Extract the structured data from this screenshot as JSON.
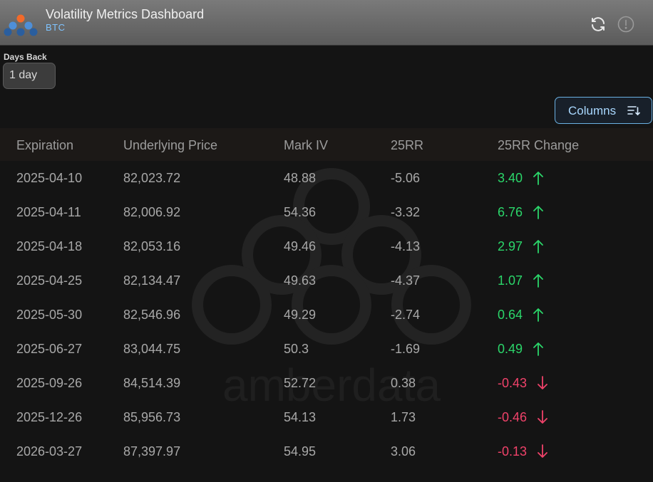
{
  "header": {
    "title": "Volatility Metrics Dashboard",
    "subtitle": "BTC",
    "icons": {
      "logo": "amberdata-logo",
      "refresh": "refresh-icon",
      "info": "alert-circle-icon"
    }
  },
  "filters": {
    "days_back_label": "Days Back",
    "days_back_value": "1 day"
  },
  "toolbar": {
    "columns_label": "Columns",
    "columns_icon": "sort-lines-icon"
  },
  "watermark_text": "amberdata",
  "colors": {
    "positive": "#2bd66a",
    "negative": "#f0426a",
    "accent": "#6bb2e4"
  },
  "table": {
    "headers": [
      "Expiration",
      "Underlying Price",
      "Mark IV",
      "25RR",
      "25RR Change"
    ],
    "rows": [
      {
        "expiration": "2025-04-10",
        "price": "82,023.72",
        "mark_iv": "48.88",
        "rr25": "-5.06",
        "change": "3.40",
        "dir": "up"
      },
      {
        "expiration": "2025-04-11",
        "price": "82,006.92",
        "mark_iv": "54.36",
        "rr25": "-3.32",
        "change": "6.76",
        "dir": "up"
      },
      {
        "expiration": "2025-04-18",
        "price": "82,053.16",
        "mark_iv": "49.46",
        "rr25": "-4.13",
        "change": "2.97",
        "dir": "up"
      },
      {
        "expiration": "2025-04-25",
        "price": "82,134.47",
        "mark_iv": "49.63",
        "rr25": "-4.37",
        "change": "1.07",
        "dir": "up"
      },
      {
        "expiration": "2025-05-30",
        "price": "82,546.96",
        "mark_iv": "49.29",
        "rr25": "-2.74",
        "change": "0.64",
        "dir": "up"
      },
      {
        "expiration": "2025-06-27",
        "price": "83,044.75",
        "mark_iv": "50.3",
        "rr25": "-1.69",
        "change": "0.49",
        "dir": "up"
      },
      {
        "expiration": "2025-09-26",
        "price": "84,514.39",
        "mark_iv": "52.72",
        "rr25": "0.38",
        "change": "-0.43",
        "dir": "down"
      },
      {
        "expiration": "2025-12-26",
        "price": "85,956.73",
        "mark_iv": "54.13",
        "rr25": "1.73",
        "change": "-0.46",
        "dir": "down"
      },
      {
        "expiration": "2026-03-27",
        "price": "87,397.97",
        "mark_iv": "54.95",
        "rr25": "3.06",
        "change": "-0.13",
        "dir": "down"
      }
    ]
  }
}
